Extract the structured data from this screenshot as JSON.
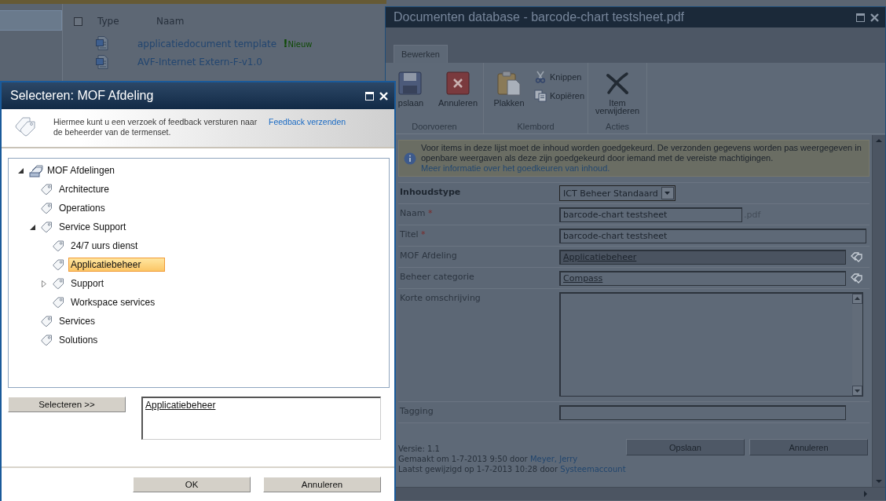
{
  "list_view": {
    "select_all": {
      "checked": false
    },
    "columns": [
      "Type",
      "Naam"
    ],
    "rows": [
      {
        "name": "applicatiedocument template",
        "badge_mark": "!",
        "badge": "Nieuw"
      },
      {
        "name": "AVF-Internet Extern-F-v1.0"
      }
    ]
  },
  "edit_dialog": {
    "title": "Documenten database - barcode-chart testsheet.pdf",
    "tabs": [
      {
        "label": "Bewerken",
        "selected": true
      }
    ],
    "ribbon": [
      {
        "label": "Doorvoeren",
        "buttons": [
          {
            "kind": "large",
            "label": "pslaan"
          },
          {
            "kind": "large",
            "label": "Annuleren"
          }
        ]
      },
      {
        "label": "Klembord",
        "buttons": [
          {
            "kind": "large",
            "label": "Plakken"
          },
          {
            "kind": "small",
            "label": "Knippen"
          },
          {
            "kind": "small",
            "label": "Kopiëren"
          }
        ]
      },
      {
        "label": "Acties",
        "buttons": [
          {
            "kind": "large",
            "label": "Item verwijderen"
          }
        ]
      }
    ],
    "notice": {
      "text": "Voor items in deze lijst moet de inhoud worden goedgekeurd. De verzonden gegevens worden pas weergegeven in openbare weergaven als deze zijn goedgekeurd door iemand met de vereiste machtigingen.",
      "link": "Meer informatie over het goedkeuren van inhoud."
    },
    "fields": [
      {
        "kind": "select",
        "label": "Inhoudstype",
        "value": "ICT Beheer Standaard"
      },
      {
        "kind": "text",
        "label": "Naam",
        "marker": "*",
        "value": "barcode-chart testsheet",
        "suffix": ".pdf"
      },
      {
        "kind": "text",
        "label": "Titel",
        "marker": "*",
        "value": "barcode-chart testsheet"
      },
      {
        "kind": "term",
        "label": "MOF Afdeling",
        "value": "Applicatiebeheer",
        "highlighted": true
      },
      {
        "kind": "term",
        "label": "Beheer categorie",
        "value": "Compass",
        "highlighted": false
      },
      {
        "kind": "textarea",
        "label": "Korte omschrijving"
      },
      {
        "kind": "keywords",
        "label": "Tagging"
      }
    ],
    "version": "Versie: 1.1",
    "history": [
      {
        "text": "Gemaakt om 1-7-2013 9:50 door ",
        "user": "Meyer, Jerry"
      },
      {
        "text": "Laatst gewijzigd op 1-7-2013 10:28 door ",
        "user": "Systeemaccount"
      }
    ],
    "buttons": [
      "Opslaan",
      "Annuleren"
    ]
  },
  "picker_dialog": {
    "title": "Selecteren: MOF Afdeling",
    "info": "Hiermee kunt u een verzoek of feedback versturen naar de beheerder van de termenset.",
    "feedback_link": "Feedback verzenden",
    "tree": [
      {
        "kind": "termset",
        "label": "MOF Afdelingen",
        "expanded": true,
        "selected": false,
        "children": [
          {
            "kind": "term",
            "label": "Architecture",
            "selected": false
          },
          {
            "kind": "term",
            "label": "Operations",
            "selected": false
          },
          {
            "kind": "term",
            "label": "Service Support",
            "expanded": true,
            "selected": false,
            "children": [
              {
                "kind": "term",
                "label": "24/7 uurs dienst",
                "selected": false
              },
              {
                "kind": "term",
                "label": "Applicatiebeheer",
                "selected": true
              },
              {
                "kind": "term",
                "label": "Support",
                "expanded": false,
                "selected": false
              },
              {
                "kind": "term",
                "label": "Workspace services",
                "selected": false
              }
            ]
          },
          {
            "kind": "term",
            "label": "Services",
            "selected": false
          },
          {
            "kind": "term",
            "label": "Solutions",
            "selected": false
          }
        ]
      }
    ],
    "select_button": "Selecteren >>",
    "selection": [
      "Applicatiebeheer"
    ],
    "buttons": [
      "OK",
      "Annuleren"
    ]
  }
}
